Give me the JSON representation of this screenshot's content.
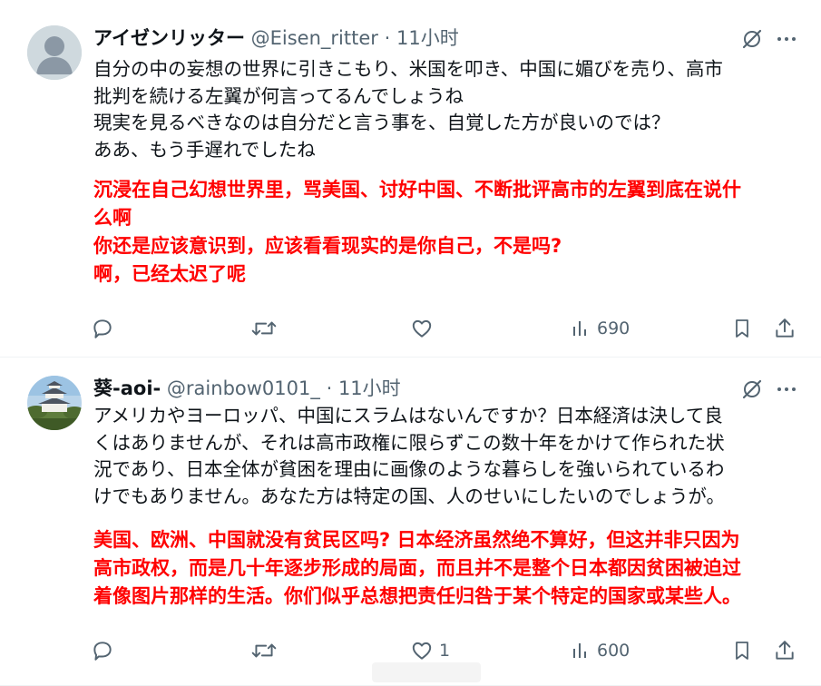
{
  "tweets": [
    {
      "name": "アイゼンリッター",
      "handle": "@Eisen_ritter",
      "sep": "·",
      "time": "11小时",
      "text_ja": [
        "自分の中の妄想の世界に引きこもり、米国を叩き、中国に媚びを売り、高市",
        "批判を続ける左翼が何言ってるんでしょうね",
        "現実を見るべきなのは自分だと言う事を、自覚した方が良いのでは？",
        "ああ、もう手遅れでしたね"
      ],
      "text_zh": [
        "沉浸在自己幻想世界里，骂美国、讨好中国、不断批评高市的左翼到底在说什",
        "么啊",
        "你还是应该意识到，应该看看现实的是你自己，不是吗?",
        "啊，已经太迟了呢"
      ],
      "reply_count": "",
      "retweet_count": "",
      "like_count": "",
      "views": "690"
    },
    {
      "name": "葵-aoi-",
      "handle": "@rainbow0101_",
      "sep": "·",
      "time": "11小时",
      "text_ja": [
        "アメリカやヨーロッパ、中国にスラムはないんですか？日本経済は決して良",
        "くはありませんが、それは高市政権に限らずこの数十年をかけて作られた状",
        "況であり、日本全体が貧困を理由に画像のような暮らしを強いられているわ",
        "けでもありません。あなた方は特定の国、人のせいにしたいのでしょうが。"
      ],
      "text_zh": [
        "美国、欧洲、中国就没有贫民区吗? 日本经济虽然绝不算好，但这并非只因为",
        "高市政权，而是几十年逐步形成的局面，而且并不是整个日本都因贫困被迫过",
        "着像图片那样的生活。你们似乎总想把责任归咎于某个特定的国家或某些人。"
      ],
      "reply_count": "",
      "retweet_count": "",
      "like_count": "1",
      "views": "600"
    }
  ],
  "icons": [
    "grok-icon",
    "more-icon",
    "reply-icon",
    "retweet-icon",
    "like-icon",
    "views-icon",
    "bookmark-icon",
    "share-icon"
  ],
  "colors": {
    "text": "#0f1419",
    "secondary": "#536471",
    "translation": "#ff0000",
    "divider": "#eff3f4"
  }
}
